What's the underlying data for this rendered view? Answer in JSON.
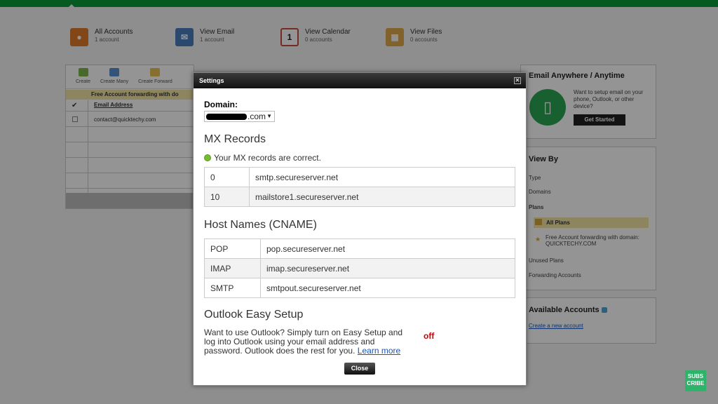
{
  "summary": [
    {
      "title": "All Accounts",
      "sub": "1 account",
      "icon": "accounts-icon",
      "color": "#e07b2a"
    },
    {
      "title": "View Email",
      "sub": "1 account",
      "icon": "email-icon",
      "color": "#4a7fc0"
    },
    {
      "title": "View Calendar",
      "sub": "0 accounts",
      "icon": "calendar-icon",
      "glyph": "1",
      "color": "#c84a3a"
    },
    {
      "title": "View Files",
      "sub": "0 accounts",
      "icon": "files-icon",
      "color": "#e0a94a"
    }
  ],
  "toolbar": {
    "create": "Create",
    "create_many": "Create Many",
    "create_forward": "Create Forward"
  },
  "grid": {
    "forward_banner": "Free Account forwarding with do",
    "col_email": "Email Address",
    "rows": [
      "contact@quicktechy.com"
    ]
  },
  "side": {
    "anywhere_title": "Email Anywhere / Anytime",
    "anywhere_text": "Want to setup email on your phone, Outlook, or other device?",
    "get_started": "Get Started",
    "view_by_title": "View By",
    "view_by": {
      "type": "Type",
      "domains": "Domains",
      "plans": "Plans",
      "all_plans": "All Plans",
      "free_fwd": "Free Account forwarding with domain: QUICKTECHY.COM",
      "unused": "Unused Plans",
      "forwarding": "Forwarding Accounts"
    },
    "available_title": "Available Accounts",
    "create_new": "Create a new account"
  },
  "modal": {
    "title": "Settings",
    "domain_label": "Domain:",
    "domain_suffix": ".com",
    "mx_title": "MX Records",
    "mx_status": "Your MX records are correct.",
    "mx_records": [
      {
        "priority": "0",
        "host": "smtp.secureserver.net"
      },
      {
        "priority": "10",
        "host": "mailstore1.secureserver.net"
      }
    ],
    "cname_title": "Host Names (CNAME)",
    "cname_records": [
      {
        "name": "POP",
        "host": "pop.secureserver.net"
      },
      {
        "name": "IMAP",
        "host": "imap.secureserver.net"
      },
      {
        "name": "SMTP",
        "host": "smtpout.secureserver.net"
      }
    ],
    "outlook_title": "Outlook Easy Setup",
    "outlook_text": "Want to use Outlook? Simply turn on Easy Setup and log into Outlook using your email address and password. Outlook does the rest for you.",
    "learn_more": "Learn more",
    "toggle_state": "off",
    "close_label": "Close"
  },
  "subscribe": {
    "line1": "SUBS",
    "line2": "CRIBE"
  }
}
